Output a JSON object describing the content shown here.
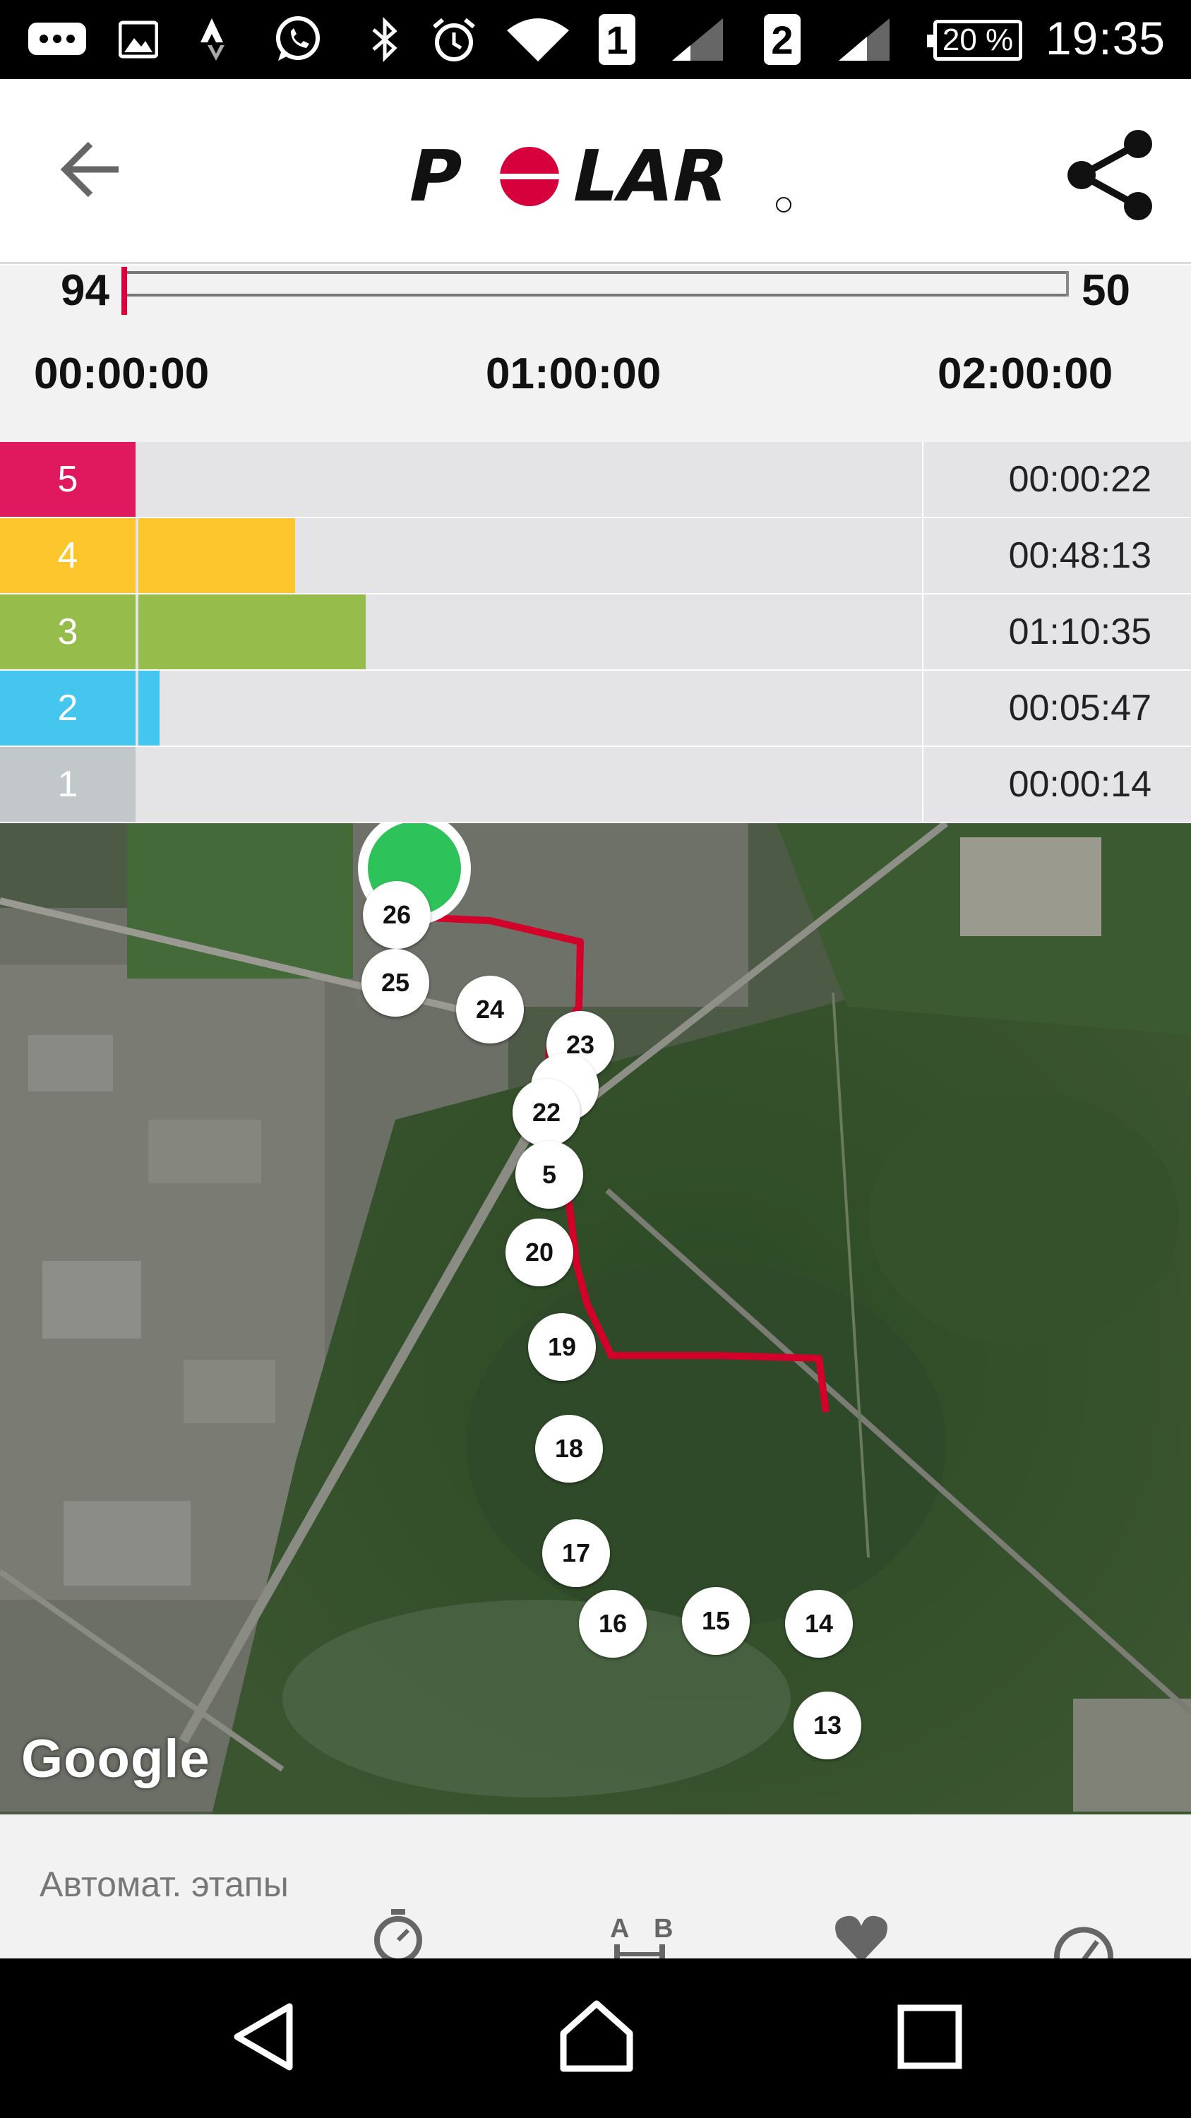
{
  "status_bar": {
    "sim1": "1",
    "sim2": "2",
    "battery": "20 %",
    "time": "19:35",
    "icons": [
      "chat-notification-icon",
      "gallery-icon",
      "strava-icon",
      "whatsapp-icon",
      "bluetooth-icon",
      "alarm-icon",
      "wifi-icon",
      "signal-icon",
      "signal-icon",
      "battery-icon"
    ]
  },
  "header": {
    "logo_text": "POLAR",
    "back_icon": "arrow-left-icon",
    "share_icon": "share-icon"
  },
  "timeline": {
    "left_value": "94",
    "right_value": "50",
    "times": [
      "00:00:00",
      "01:00:00",
      "02:00:00"
    ],
    "position_fraction": 0
  },
  "zones": [
    {
      "label": "5",
      "time": "00:00:22",
      "color": "#e0185e",
      "fill_fraction": 0.0
    },
    {
      "label": "4",
      "time": "00:48:13",
      "color": "#fdc62c",
      "fill_fraction": 0.2
    },
    {
      "label": "3",
      "time": "01:10:35",
      "color": "#96bd4b",
      "fill_fraction": 0.29
    },
    {
      "label": "2",
      "time": "00:05:47",
      "color": "#45c6ef",
      "fill_fraction": 0.027
    },
    {
      "label": "1",
      "time": "00:00:14",
      "color": "#c2c7c9",
      "fill_fraction": 0.0
    }
  ],
  "map": {
    "route_color": "#d3002a",
    "attribution": "Google",
    "laps": [
      "26",
      "25",
      "24",
      "23",
      "22",
      "5",
      "20",
      "19",
      "18",
      "17",
      "16",
      "15",
      "14",
      "13"
    ]
  },
  "bottom_panel": {
    "title": "Автомат. этапы",
    "ab_label_a": "A",
    "ab_label_b": "B",
    "icons": [
      "stopwatch-icon",
      "ab-laps-icon",
      "heart-icon",
      "speed-gauge-icon"
    ]
  },
  "nav_bar": {
    "icons": [
      "nav-back-icon",
      "nav-home-icon",
      "nav-recents-icon"
    ]
  }
}
